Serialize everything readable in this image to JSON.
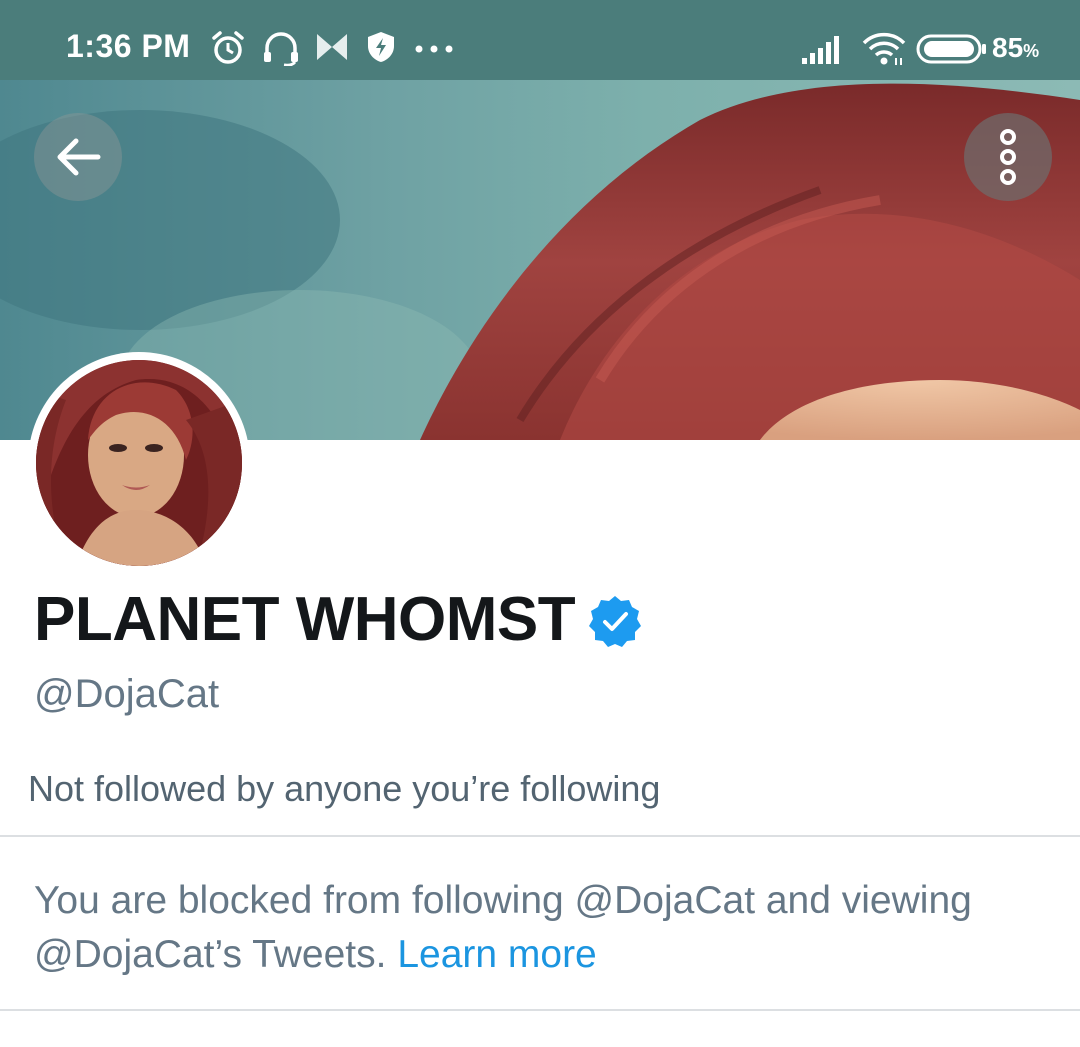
{
  "status_bar": {
    "time": "1:36 PM",
    "battery_percent": "85",
    "battery_unit": "%",
    "icons": [
      "alarm-icon",
      "headset-icon",
      "app-notification-icon",
      "shield-bolt-icon",
      "more-notifications-icon",
      "signal-icon",
      "wifi-icon",
      "battery-icon"
    ],
    "background_color": "#4b7d7b"
  },
  "header": {
    "back_icon": "arrow-left-icon",
    "more_icon": "more-vertical-icon"
  },
  "profile": {
    "display_name": "PLANET WHOMST",
    "verified": true,
    "verified_color": "#1d9bf0",
    "handle": "@DojaCat",
    "followers_note": "Not followed by anyone you’re following"
  },
  "blocked_notice": {
    "text": "You are blocked from following @DojaCat and viewing @DojaCat’s Tweets.",
    "link_label": "Learn more",
    "link_color": "#1b95e0"
  }
}
